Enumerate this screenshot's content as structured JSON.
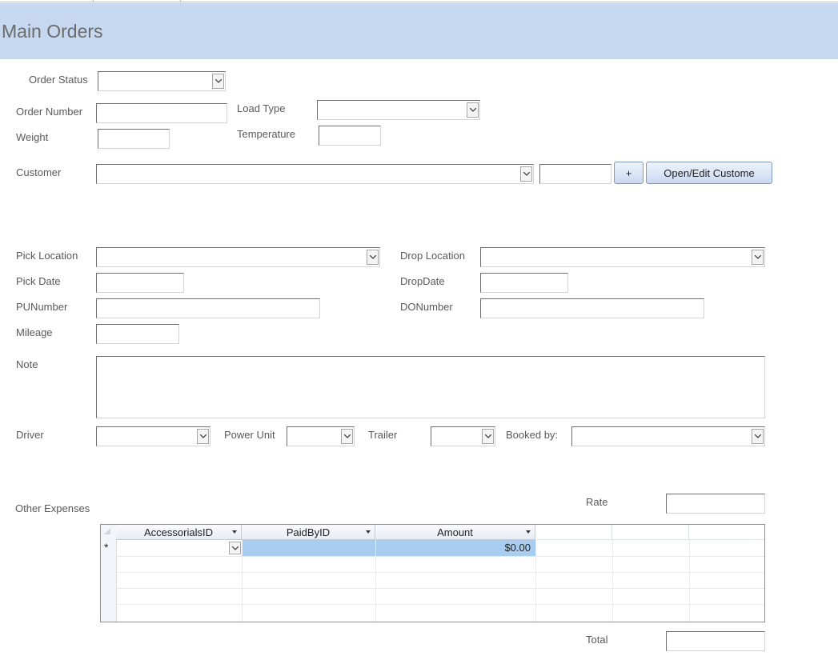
{
  "header": {
    "title": "Main Orders"
  },
  "fields": {
    "order_status": {
      "label": "Order Status",
      "value": ""
    },
    "order_number": {
      "label": "Order Number",
      "value": ""
    },
    "load_type": {
      "label": "Load Type",
      "value": ""
    },
    "weight": {
      "label": "Weight",
      "value": ""
    },
    "temperature": {
      "label": "Temperature",
      "value": ""
    },
    "customer": {
      "label": "Customer",
      "value": "",
      "id_value": ""
    },
    "pick_location": {
      "label": "Pick Location",
      "value": ""
    },
    "drop_location": {
      "label": "Drop Location",
      "value": ""
    },
    "pick_date": {
      "label": "Pick Date",
      "value": ""
    },
    "drop_date": {
      "label": "DropDate",
      "value": ""
    },
    "pu_number": {
      "label": "PUNumber",
      "value": ""
    },
    "do_number": {
      "label": "DONumber",
      "value": ""
    },
    "mileage": {
      "label": "Mileage",
      "value": ""
    },
    "note": {
      "label": "Note",
      "value": ""
    },
    "driver": {
      "label": "Driver",
      "value": ""
    },
    "power_unit": {
      "label": "Power Unit",
      "value": ""
    },
    "trailer": {
      "label": "Trailer",
      "value": ""
    },
    "booked_by": {
      "label": "Booked by:",
      "value": ""
    },
    "rate": {
      "label": "Rate",
      "value": ""
    },
    "total": {
      "label": "Total",
      "value": ""
    }
  },
  "buttons": {
    "add_customer": "+",
    "open_edit_customer": "Open/Edit Custome"
  },
  "other_expenses": {
    "label": "Other Expenses",
    "columns": [
      "AccessorialsID",
      "PaidByID",
      "Amount"
    ],
    "new_row": {
      "marker": "*",
      "accessorials_id": "",
      "paid_by_id": "",
      "amount": "$0.00"
    }
  },
  "colors": {
    "header_bg": "#c6d8f0",
    "selected_cell": "#a9cdf0"
  },
  "icons": [
    "chevron-down-icon",
    "sort-arrow-icon",
    "new-record-icon"
  ]
}
